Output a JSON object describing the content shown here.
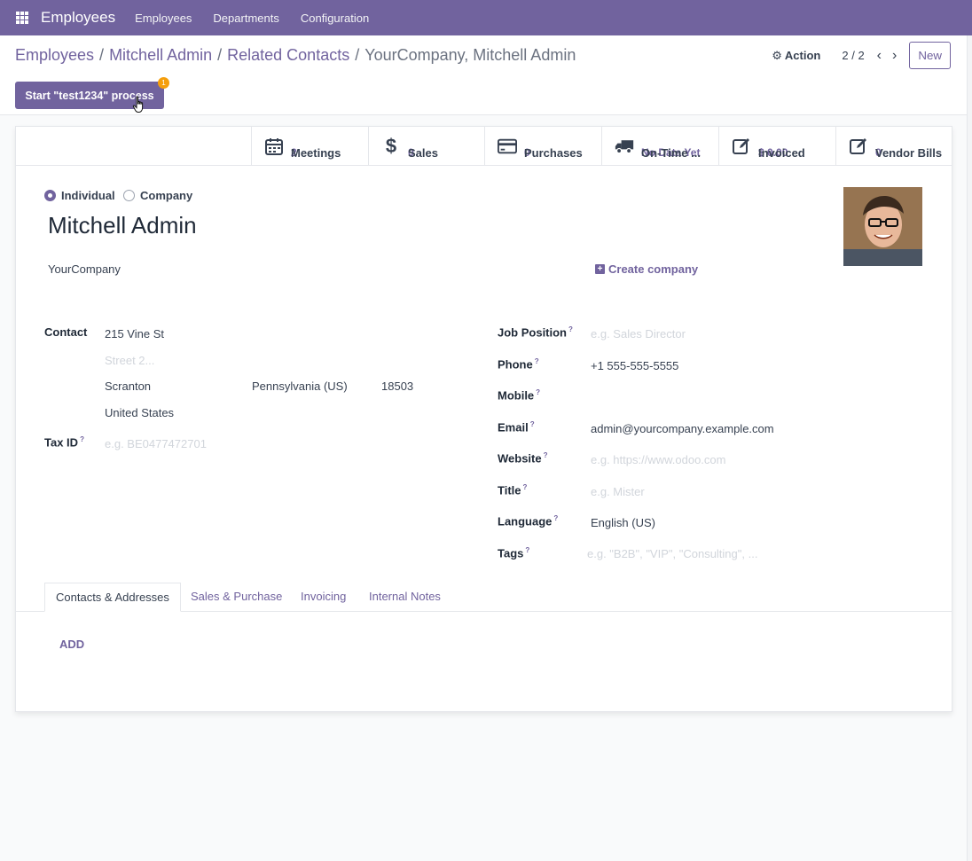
{
  "navbar": {
    "app_title": "Employees",
    "menu": [
      "Employees",
      "Departments",
      "Configuration"
    ]
  },
  "breadcrumb": {
    "items": [
      "Employees",
      "Mitchell Admin",
      "Related Contacts"
    ],
    "current": "YourCompany, Mitchell Admin"
  },
  "control": {
    "action_label": "Action",
    "pager": "2 / 2",
    "new_label": "New",
    "start_button": "Start \"test1234\" process",
    "badge_count": "1"
  },
  "stats": [
    {
      "value": "2",
      "label": "Meetings",
      "icon": "calendar-icon"
    },
    {
      "value": "0",
      "label": "Sales",
      "icon": "dollar-icon"
    },
    {
      "value": "0",
      "label": "Purchases",
      "icon": "credit-card-icon"
    },
    {
      "value": "No Data Yet",
      "label": "On-Time ...",
      "icon": "truck-icon"
    },
    {
      "value": "$ 0.00",
      "label": "Invoiced",
      "icon": "edit-icon"
    },
    {
      "value": "0",
      "label": "Vendor Bills",
      "icon": "edit-icon"
    }
  ],
  "type": {
    "individual": "Individual",
    "company": "Company",
    "selected": "Individual"
  },
  "partner": {
    "name": "Mitchell Admin",
    "parent_company": "YourCompany",
    "create_company": "Create company"
  },
  "address": {
    "label": "Contact",
    "street": "215 Vine St",
    "street2_placeholder": "Street 2...",
    "city": "Scranton",
    "state": "Pennsylvania (US)",
    "zip": "18503",
    "country": "United States"
  },
  "tax": {
    "label": "Tax ID",
    "placeholder": "e.g. BE0477472701"
  },
  "fields": {
    "job_position": {
      "label": "Job Position",
      "placeholder": "e.g. Sales Director"
    },
    "phone": {
      "label": "Phone",
      "value": "+1 555-555-5555"
    },
    "mobile": {
      "label": "Mobile",
      "value": ""
    },
    "email": {
      "label": "Email",
      "value": "admin@yourcompany.example.com"
    },
    "website": {
      "label": "Website",
      "placeholder": "e.g. https://www.odoo.com"
    },
    "title": {
      "label": "Title",
      "placeholder": "e.g. Mister"
    },
    "language": {
      "label": "Language",
      "value": "English (US)"
    },
    "tags": {
      "label": "Tags",
      "placeholder": "e.g. \"B2B\", \"VIP\", \"Consulting\", ..."
    }
  },
  "tooltip_marker": "?",
  "tabs": [
    "Contacts & Addresses",
    "Sales & Purchase",
    "Invoicing",
    "Internal Notes"
  ],
  "add_label": "ADD",
  "colors": {
    "brand": "#71639e",
    "badge": "#f59e0b"
  }
}
